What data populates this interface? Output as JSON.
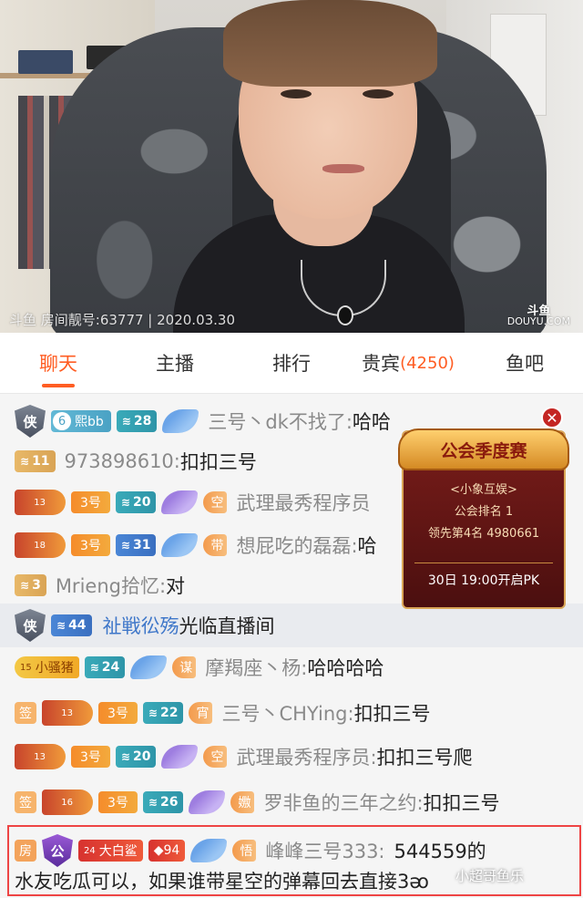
{
  "video": {
    "watermark": "斗鱼 房间靓号:63777 | 2020.03.30",
    "logo_cn": "斗鱼",
    "logo_en": "DOUYU.COM"
  },
  "tabs": [
    {
      "label": "聊天",
      "active": true
    },
    {
      "label": "主播"
    },
    {
      "label": "排行"
    },
    {
      "label": "贵宾",
      "count": "(4250)"
    },
    {
      "label": "鱼吧"
    }
  ],
  "accent_color": "#ff5d23",
  "chat": [
    {
      "shield": "侠",
      "fan_lv": "6",
      "fan_name": "熙bb",
      "user_lv": "28",
      "nick": "三号丶dk不找了:",
      "text": "哈哈"
    },
    {
      "user_lv": "11",
      "nick": "973898610:",
      "text": "扣扣三号"
    },
    {
      "dragon_lv": "13",
      "room_badge": "3号",
      "user_lv": "20",
      "title": "空",
      "nick": "武理最秀程序员",
      "text": ""
    },
    {
      "dragon_lv": "18",
      "room_badge": "3号",
      "user_lv": "31",
      "title": "带",
      "nick": "想屁吃的磊磊:",
      "text": "哈"
    },
    {
      "user_lv": "3",
      "nick": "Mrieng拾忆:",
      "text": "对"
    },
    {
      "system": true,
      "shield": "侠",
      "user_lv": "44",
      "name": "祉戦彸殇",
      "text": "光临直播间"
    },
    {
      "gold_lv": "15",
      "gold_name": "小骚猪",
      "user_lv": "24",
      "title": "谋",
      "nick": "摩羯座丶杨:",
      "text": "哈哈哈哈"
    },
    {
      "sign": "签",
      "dragon_lv": "13",
      "room_badge": "3号",
      "user_lv": "22",
      "title": "宵",
      "nick": "三号丶CHYing:",
      "text": "扣扣三号"
    },
    {
      "dragon_lv": "13",
      "room_badge": "3号",
      "user_lv": "20",
      "title": "空",
      "nick": "武理最秀程序员:",
      "text": "扣扣三号爬"
    },
    {
      "sign": "签",
      "dragon_lv": "16",
      "room_badge": "3号",
      "user_lv": "26",
      "title": "嫐",
      "nick": "罗非鱼的三年之约:",
      "text": "扣扣三号"
    }
  ],
  "last_message": {
    "sign": "房",
    "crest": "公",
    "red_lv": "24",
    "red_name": "大白鲨",
    "user_lv": "94",
    "title": "悟",
    "nick": "峰峰三号333:",
    "text_line1": "544559的",
    "text_line2": "水友吃瓜可以，如果谁带星空的弹幕回去直接3ᴔ"
  },
  "popup": {
    "title": "公会季度赛",
    "guild": "<小象互娱>",
    "rank": "公会排名 1",
    "lead": "领先第4名 4980661",
    "button": "30日 19:00开启PK",
    "close": "✕"
  },
  "corner_watermark": "小超哥鱼乐"
}
